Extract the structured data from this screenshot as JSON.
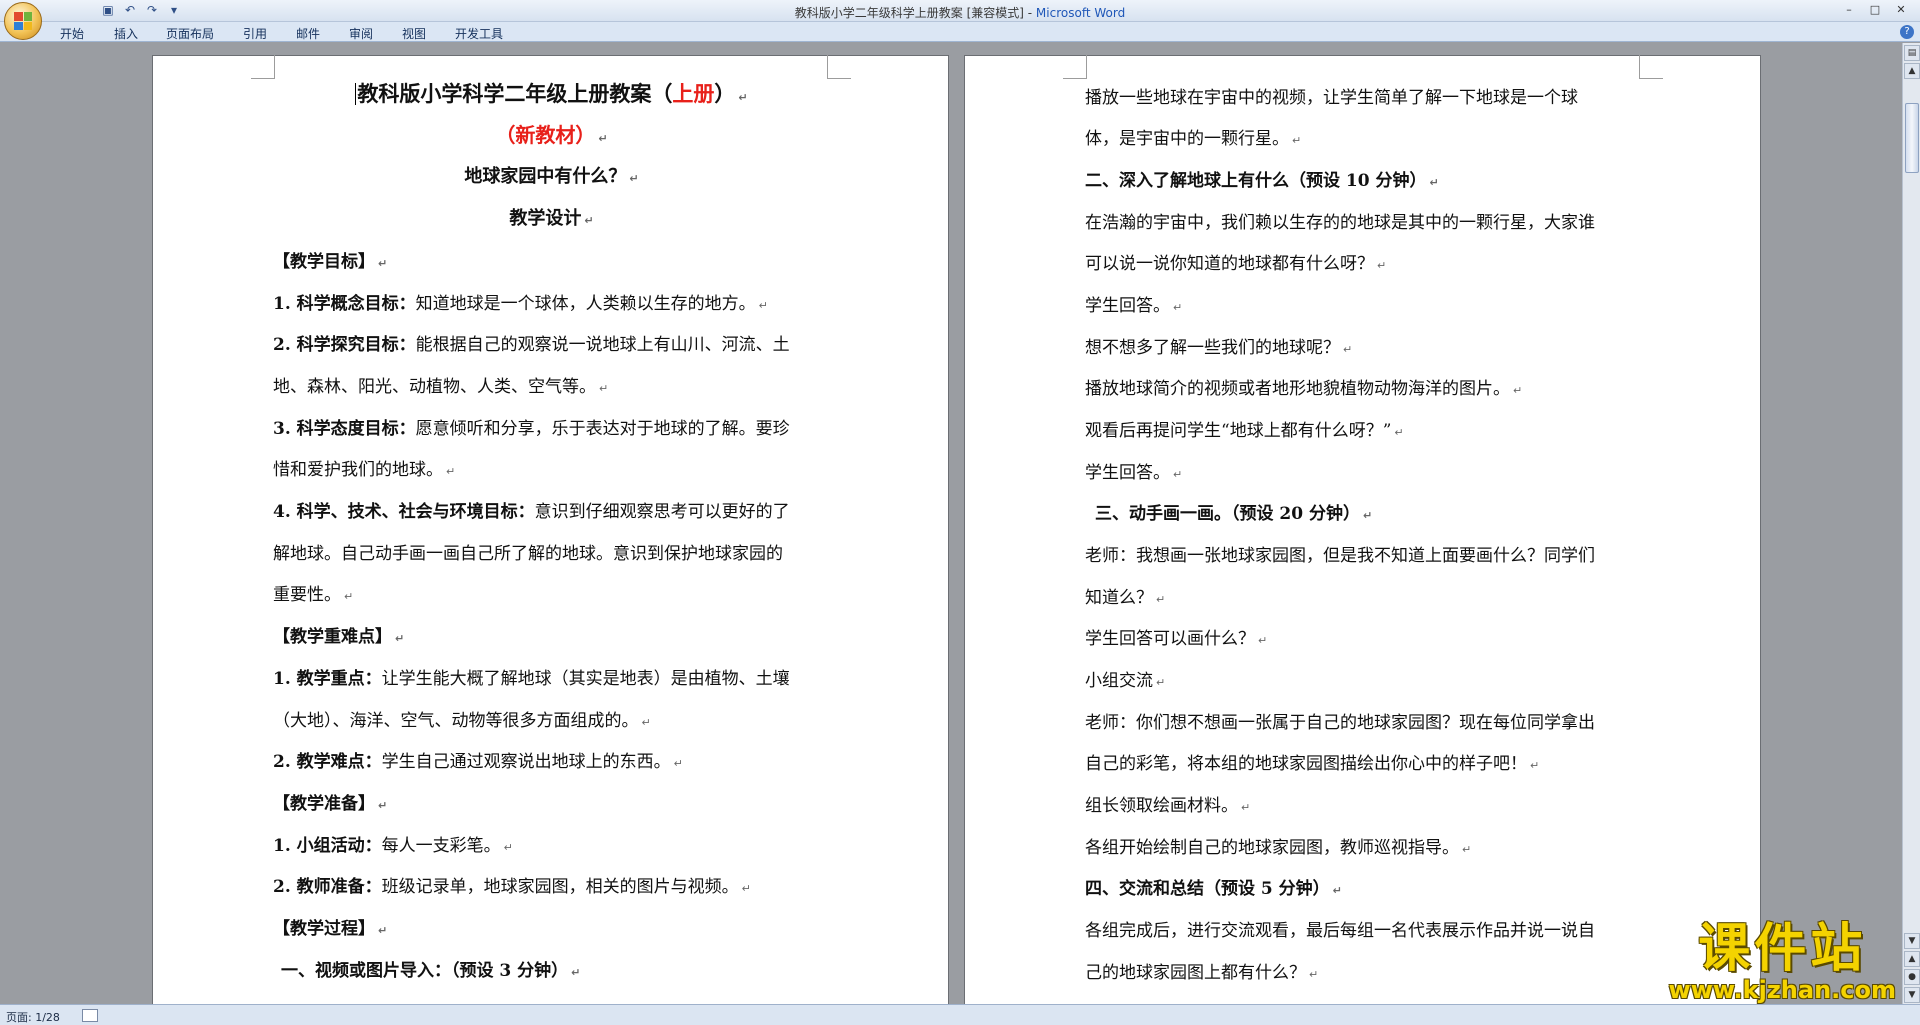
{
  "window": {
    "title": "教科版小学二年级科学上册教案 [兼容模式] - ",
    "app": "Microsoft Word",
    "minimize": "–",
    "maximize": "□",
    "close": "✕"
  },
  "qat": {
    "save_icon": "save-icon",
    "undo_icon": "undo-icon",
    "redo_icon": "redo-icon",
    "more": "▾"
  },
  "tabs": [
    "开始",
    "插入",
    "页面布局",
    "引用",
    "邮件",
    "审阅",
    "视图",
    "开发工具"
  ],
  "help": "?",
  "status": {
    "page": "页面: 1/28"
  },
  "left_page": {
    "title": "教科版小学科学二年级上册教案（",
    "title_red": "上册",
    "title_end": "）",
    "subtitle": "（新教材）",
    "lesson": "地球家园中有什么？",
    "design": "教学设计",
    "h_goals": "【教学目标】",
    "g1_b": "1. 科学概念目标：",
    "g1_t": "知道地球是一个球体，人类赖以生存的地方。",
    "g2_b": "2. 科学探究目标：",
    "g2_t": "能根据自己的观察说一说地球上有山川、河流、土",
    "g2_t2": "地、森林、阳光、动植物、人类、空气等。",
    "g3_b": "3. 科学态度目标：",
    "g3_t": "愿意倾听和分享，乐于表达对于地球的了解。要珍",
    "g3_t2": "惜和爱护我们的地球。",
    "g4_b": "4. 科学、技术、社会与环境目标：",
    "g4_t": "意识到仔细观察思考可以更好的了",
    "g4_t2": "解地球。自己动手画一画自己所了解的地球。意识到保护地球家园的",
    "g4_t3": "重要性。",
    "h_key": "【教学重难点】",
    "k1_b": "1. 教学重点：",
    "k1_t": "让学生能大概了解地球（其实是地表）是由植物、土壤",
    "k1_t2": "（大地）、海洋、空气、动物等很多方面组成的。",
    "k2_b": "2. 教学难点：",
    "k2_t": "学生自己通过观察说出地球上的东西。",
    "h_prep": "【教学准备】",
    "p1_b": "1. 小组活动：",
    "p1_t": "每人一支彩笔。",
    "p2_b": "2. 教师准备：",
    "p2_t": "班级记录单，地球家园图，相关的图片与视频。",
    "h_proc": "【教学过程】",
    "s1": "一、视频或图片导入：（预设 3 分钟）"
  },
  "right_page": {
    "r1": "播放一些地球在宇宙中的视频，让学生简单了解一下地球是一个球",
    "r2": "体，是宇宙中的一颗行星。",
    "s2": "二、深入了解地球上有什么（预设 10 分钟）",
    "r3": "在浩瀚的宇宙中，我们赖以生存的的地球是其中的一颗行星，大家谁",
    "r4": "可以说一说你知道的地球都有什么呀？",
    "r5": "学生回答。",
    "r6": "想不想多了解一些我们的地球呢？",
    "r7": "播放地球简介的视频或者地形地貌植物动物海洋的图片。",
    "r8": "观看后再提问学生“地球上都有什么呀？”",
    "r9": "学生回答。",
    "s3": "三、动手画一画。（预设 20 分钟）",
    "r10": "老师：我想画一张地球家园图，但是我不知道上面要画什么？同学们",
    "r11": "知道么？",
    "r12": "学生回答可以画什么？",
    "r13": "小组交流",
    "r14": "老师：你们想不想画一张属于自己的地球家园图？现在每位同学拿出",
    "r15": "自己的彩笔，将本组的地球家园图描绘出你心中的样子吧！",
    "r16": "组长领取绘画材料。",
    "r17": "各组开始绘制自己的地球家园图，教师巡视指导。",
    "s4": "四、交流和总结（预设 5 分钟）",
    "r18": "各组完成后，进行交流观看，最后每组一名代表展示作品并说一说自",
    "r19": "己的地球家园图上都有什么？"
  },
  "para_mark": "↵",
  "watermark": {
    "title": "课件站",
    "url": "www.kjzhan.com"
  },
  "colors": {
    "accent_red": "#e8201a",
    "watermark_yellow": "#f4d300",
    "ribbon_blue": "#dbe6f4"
  }
}
